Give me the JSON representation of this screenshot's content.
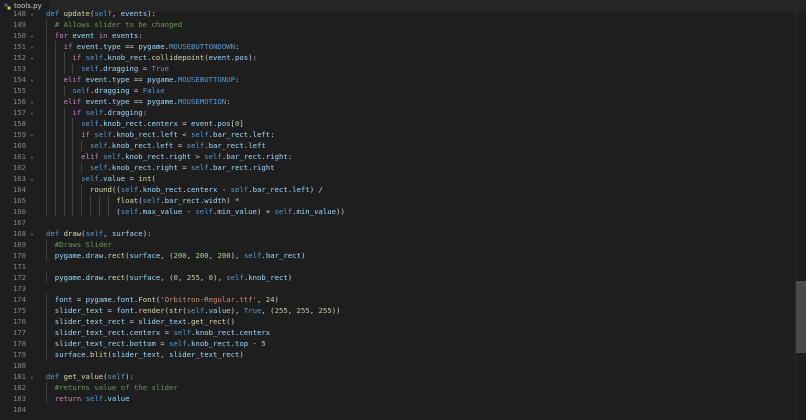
{
  "tab": {
    "filename": "tools.py",
    "icon": "python-file-icon"
  },
  "colors": {
    "background": "#1e1e1e",
    "line_number": "#858585",
    "keyword": "#c586c0",
    "keyword_blue": "#569cd6",
    "function": "#dcdcaa",
    "variable": "#9cdcfe",
    "number": "#b5cea8",
    "string": "#ce9178",
    "comment": "#6a9955"
  },
  "scrollbar": {
    "position_fraction": 0.8
  },
  "lines": [
    {
      "n": "148",
      "fold": "v",
      "text": "def update(self, events):"
    },
    {
      "n": "149",
      "fold": "",
      "text": "  # Allows slider to be changed"
    },
    {
      "n": "150",
      "fold": "v",
      "text": "  for event in events:"
    },
    {
      "n": "151",
      "fold": "v",
      "text": "    if event.type == pygame.MOUSEBUTTONDOWN:"
    },
    {
      "n": "152",
      "fold": "v",
      "text": "      if self.knob_rect.collidepoint(event.pos):"
    },
    {
      "n": "153",
      "fold": "",
      "text": "        self.dragging = True"
    },
    {
      "n": "154",
      "fold": "v",
      "text": "    elif event.type == pygame.MOUSEBUTTONUP:"
    },
    {
      "n": "155",
      "fold": "",
      "text": "      self.dragging = False"
    },
    {
      "n": "156",
      "fold": "v",
      "text": "    elif event.type == pygame.MOUSEMOTION:"
    },
    {
      "n": "157",
      "fold": "v",
      "text": "      if self.dragging:"
    },
    {
      "n": "158",
      "fold": "",
      "text": "        self.knob_rect.centerx = event.pos[0]"
    },
    {
      "n": "159",
      "fold": "v",
      "text": "        if self.knob_rect.left < self.bar_rect.left:"
    },
    {
      "n": "160",
      "fold": "",
      "text": "          self.knob_rect.left = self.bar_rect.left"
    },
    {
      "n": "161",
      "fold": "v",
      "text": "        elif self.knob_rect.right > self.bar_rect.right:"
    },
    {
      "n": "162",
      "fold": "",
      "text": "          self.knob_rect.right = self.bar_rect.right"
    },
    {
      "n": "163",
      "fold": "v",
      "text": "        self.value = int("
    },
    {
      "n": "164",
      "fold": "",
      "text": "          round((self.knob_rect.centerx - self.bar_rect.left) /"
    },
    {
      "n": "165",
      "fold": "",
      "text": "                float(self.bar_rect.width) *"
    },
    {
      "n": "166",
      "fold": "",
      "text": "                (self.max_value - self.min_value) + self.min_value))"
    },
    {
      "n": "167",
      "fold": "",
      "text": ""
    },
    {
      "n": "168",
      "fold": "v",
      "text": "def draw(self, surface):"
    },
    {
      "n": "169",
      "fold": "",
      "text": "  #Draws Slider"
    },
    {
      "n": "170",
      "fold": "",
      "text": "  pygame.draw.rect(surface, (200, 200, 200), self.bar_rect)"
    },
    {
      "n": "171",
      "fold": "",
      "text": ""
    },
    {
      "n": "172",
      "fold": "",
      "text": "  pygame.draw.rect(surface, (0, 255, 0), self.knob_rect)"
    },
    {
      "n": "173",
      "fold": "",
      "text": ""
    },
    {
      "n": "174",
      "fold": "",
      "text": "  font = pygame.font.Font('Orbitron-Regular.ttf', 24)"
    },
    {
      "n": "175",
      "fold": "",
      "text": "  slider_text = font.render(str(self.value), True, (255, 255, 255))"
    },
    {
      "n": "176",
      "fold": "",
      "text": "  slider_text_rect = slider_text.get_rect()"
    },
    {
      "n": "177",
      "fold": "",
      "text": "  slider_text_rect.centerx = self.knob_rect.centerx"
    },
    {
      "n": "178",
      "fold": "",
      "text": "  slider_text_rect.bottom = self.knob_rect.top - 5"
    },
    {
      "n": "179",
      "fold": "",
      "text": "  surface.blit(slider_text, slider_text_rect)"
    },
    {
      "n": "180",
      "fold": "",
      "text": ""
    },
    {
      "n": "181",
      "fold": "v",
      "text": "def get_value(self):"
    },
    {
      "n": "182",
      "fold": "",
      "text": "  #returns value of the slider"
    },
    {
      "n": "183",
      "fold": "",
      "text": "  return self.value"
    },
    {
      "n": "184",
      "fold": "",
      "text": ""
    }
  ]
}
